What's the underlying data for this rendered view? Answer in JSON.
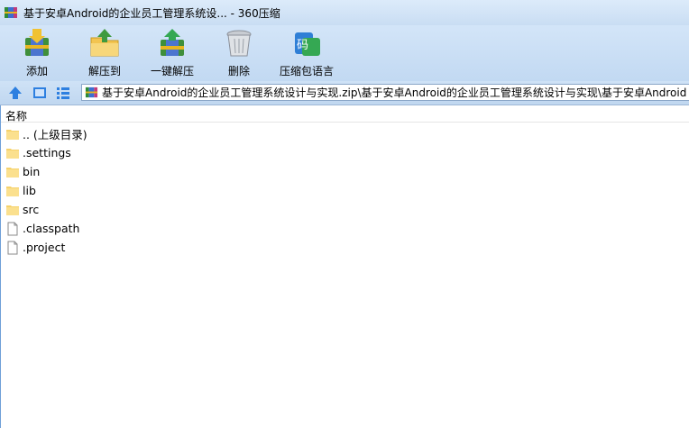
{
  "window": {
    "title": "基于安卓Android的企业员工管理系统设... - 360压缩"
  },
  "toolbar": {
    "buttons": [
      {
        "label": "添加",
        "icon": "add-archive-icon"
      },
      {
        "label": "解压到",
        "icon": "extract-to-icon"
      },
      {
        "label": "一键解压",
        "icon": "one-click-extract-icon"
      },
      {
        "label": "删除",
        "icon": "delete-icon"
      },
      {
        "label": "压缩包语言",
        "icon": "archive-language-icon"
      }
    ]
  },
  "navbar": {
    "icons": [
      "up-arrow-icon",
      "view-icon",
      "list-view-icon"
    ],
    "path": "基于安卓Android的企业员工管理系统设计与实现.zip\\基于安卓Android的企业员工管理系统设计与实现\\基于安卓Android"
  },
  "list": {
    "column_name": "名称",
    "items": [
      {
        "name": ".. (上级目录)",
        "type": "folder"
      },
      {
        "name": ".settings",
        "type": "folder"
      },
      {
        "name": "bin",
        "type": "folder"
      },
      {
        "name": "lib",
        "type": "folder"
      },
      {
        "name": "src",
        "type": "folder"
      },
      {
        "name": ".classpath",
        "type": "file"
      },
      {
        "name": ".project",
        "type": "file"
      }
    ]
  }
}
